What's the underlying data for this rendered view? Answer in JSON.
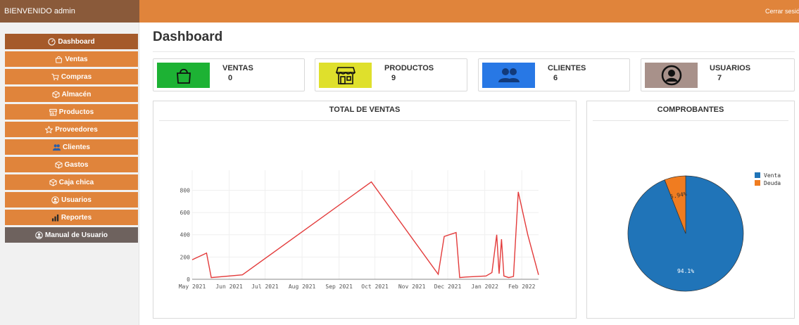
{
  "topbar": {
    "welcome": "BIENVENIDO admin",
    "logout": "Cerrar sesión"
  },
  "sidebar": {
    "items": [
      {
        "label": "Dashboard",
        "icon": "dashboard-icon",
        "active": true
      },
      {
        "label": "Ventas",
        "icon": "bag-icon"
      },
      {
        "label": "Compras",
        "icon": "cart-icon"
      },
      {
        "label": "Almacén",
        "icon": "box-icon"
      },
      {
        "label": "Productos",
        "icon": "store-icon"
      },
      {
        "label": "Proveedores",
        "icon": "star-icon"
      },
      {
        "label": "Clientes",
        "icon": "users-icon"
      },
      {
        "label": "Gastos",
        "icon": "box-icon"
      },
      {
        "label": "Caja chica",
        "icon": "box-icon"
      },
      {
        "label": "Usuarios",
        "icon": "user-circle-icon"
      },
      {
        "label": "Reportes",
        "icon": "bar-chart-icon"
      }
    ],
    "manual": {
      "label": "Manual de Usuario",
      "icon": "user-circle-icon"
    }
  },
  "page": {
    "title": "Dashboard"
  },
  "cards": [
    {
      "label": "VENTAS",
      "value": "0",
      "icon": "bag-icon",
      "color": "#1db234"
    },
    {
      "label": "PRODUCTOS",
      "value": "9",
      "icon": "store-icon",
      "color": "#dfe02c"
    },
    {
      "label": "CLIENTES",
      "value": "6",
      "icon": "users-icon",
      "color": "#2878e5"
    },
    {
      "label": "USUARIOS",
      "value": "7",
      "icon": "user-circle-icon",
      "color": "#a8918a"
    }
  ],
  "colors": {
    "accent": "#e0843b",
    "active": "#a55a2a",
    "manual": "#6e625e",
    "line": "#e33b3b",
    "pie_venta": "#2074b8",
    "pie_deuda": "#f07c20"
  },
  "chart_data": [
    {
      "type": "line",
      "title": "TOTAL DE VENTAS",
      "x": [
        "2021-05-01",
        "2021-05-13",
        "2021-05-17",
        "2021-06-12",
        "2021-09-28",
        "2021-11-23",
        "2021-11-28",
        "2021-12-08",
        "2021-12-11",
        "2021-12-16",
        "2022-01-02",
        "2022-01-07",
        "2022-01-11",
        "2022-01-13",
        "2022-01-15",
        "2022-01-17",
        "2022-01-21",
        "2022-01-25",
        "2022-01-29",
        "2022-02-06",
        "2022-02-15"
      ],
      "series": [
        {
          "values": [
            175,
            235,
            15,
            40,
            875,
            45,
            385,
            420,
            15,
            20,
            30,
            60,
            400,
            50,
            360,
            30,
            15,
            25,
            785,
            400,
            40
          ]
        }
      ],
      "x_ticks": [
        "May 2021",
        "Jun 2021",
        "Jul 2021",
        "Aug 2021",
        "Sep 2021",
        "Oct 2021",
        "Nov 2021",
        "Dec 2021",
        "Jan 2022",
        "Feb 2022"
      ],
      "y_ticks": [
        0,
        200,
        400,
        600,
        800
      ],
      "ylim": [
        0,
        980
      ],
      "grid": true
    },
    {
      "type": "pie",
      "title": "COMPROBANTES",
      "categories": [
        "Venta",
        "Deuda"
      ],
      "values": [
        94.1,
        5.94
      ],
      "labels": [
        "94.1%",
        "5.94%"
      ],
      "legend": "top-right"
    }
  ]
}
